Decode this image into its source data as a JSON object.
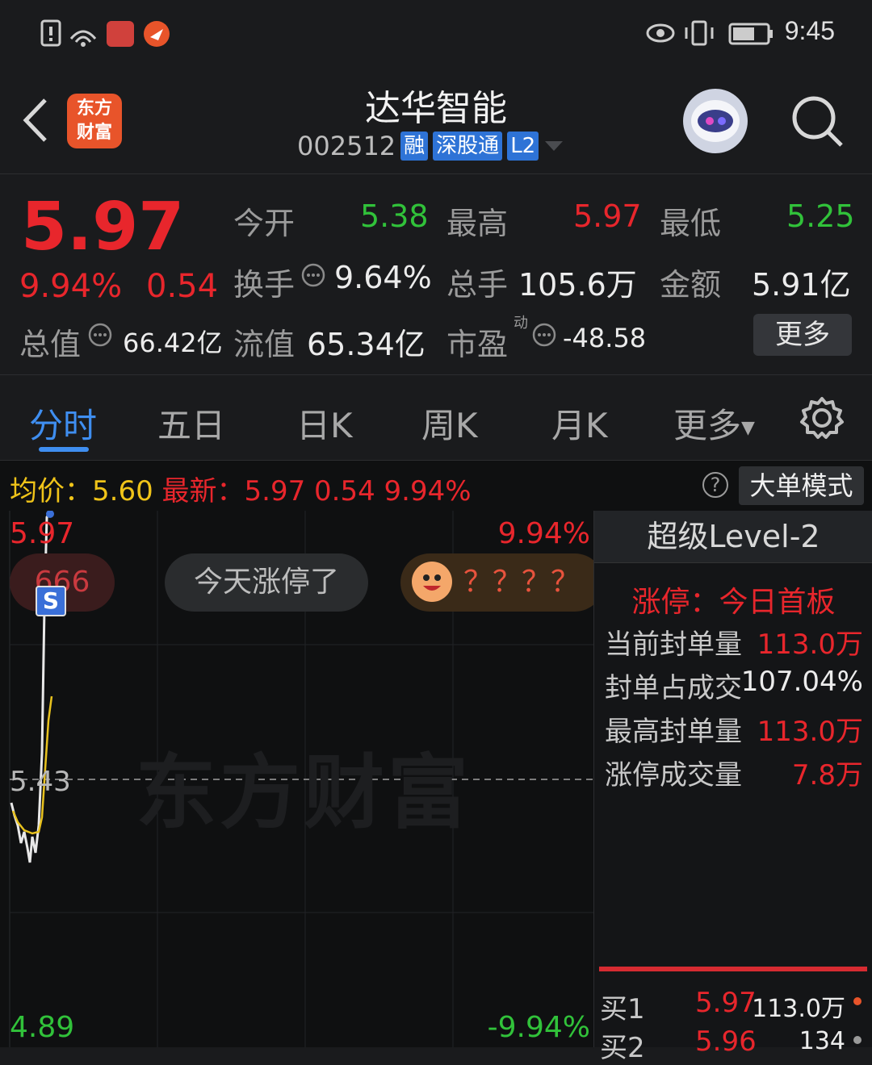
{
  "status_bar": {
    "time": "9:45"
  },
  "header": {
    "back_label": "<",
    "logo_line1": "东方",
    "logo_line2": "财富",
    "title": "达华智能",
    "code": "002512",
    "tags": [
      "融",
      "深股通",
      "L2"
    ]
  },
  "quote": {
    "price": "5.97",
    "change_pct": "9.94%",
    "change": "0.54",
    "open_label": "今开",
    "open": "5.38",
    "high_label": "最高",
    "high": "5.97",
    "low_label": "最低",
    "low": "5.25",
    "turnover_label": "换手",
    "turnover": "9.64%",
    "volume_label": "总手",
    "volume": "105.6万",
    "amount_label": "金额",
    "amount": "5.91亿",
    "mktcap_label": "总值",
    "mktcap": "66.42亿",
    "float_label": "流值",
    "float": "65.34亿",
    "pe_label": "市盈",
    "pe_sup": "动",
    "pe": "-48.58",
    "more_label": "更多"
  },
  "tabs": [
    "分时",
    "五日",
    "日K",
    "周K",
    "月K",
    "更多"
  ],
  "info_bar": {
    "avg_label": "均价：",
    "avg": "5.60",
    "latest_label": "最新：",
    "latest": "5.97",
    "latest_change": "0.54",
    "latest_pct": "9.94%",
    "help": "?",
    "big_order_label": "大单模式"
  },
  "chart": {
    "y_top": "5.97",
    "y_mid": "5.43",
    "y_bottom": "4.89",
    "pct_top": "9.94%",
    "pct_bottom": "-9.94%",
    "badge_count": "666",
    "marker": "S",
    "bubble_today": "今天涨停了",
    "bubble_question": "？？？？",
    "watermark": "东方财富",
    "colors": {
      "price_line": "#e8e8e8",
      "avg_line": "#e8c21e",
      "marker": "#3a6fd8"
    }
  },
  "level2": {
    "title": "超级Level-2",
    "limit_label": "涨停：今日首板",
    "rows": [
      {
        "label": "当前封单量",
        "value": "113.0万"
      },
      {
        "label": "封单占成交",
        "value": "107.04%"
      },
      {
        "label": "最高封单量",
        "value": "113.0万"
      },
      {
        "label": "涨停成交量",
        "value": "7.8万"
      }
    ],
    "bids": [
      {
        "label": "买1",
        "price": "5.97",
        "volume": "113.0万"
      },
      {
        "label": "买2",
        "price": "5.96",
        "volume": "134"
      }
    ]
  }
}
